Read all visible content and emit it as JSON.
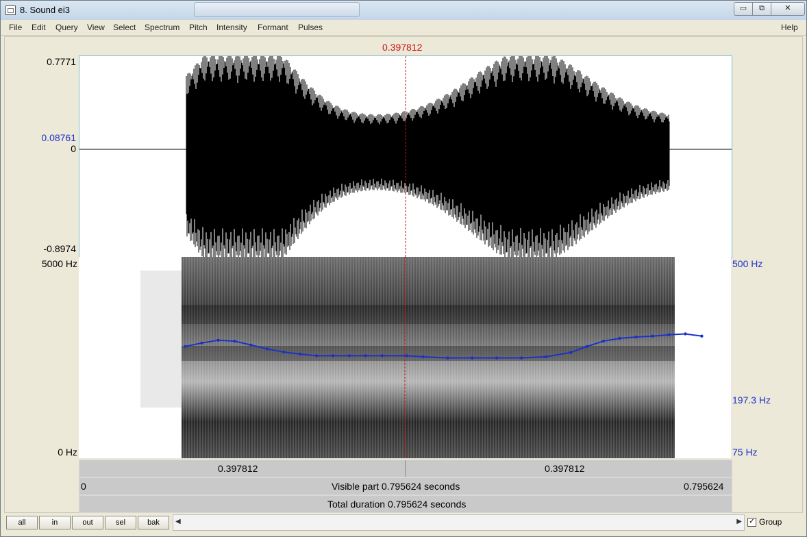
{
  "window": {
    "title": "8. Sound ei3",
    "minimize_label": "▭",
    "maximize_label": "⧉",
    "close_label": "✕"
  },
  "menu": {
    "items": [
      "File",
      "Edit",
      "Query",
      "View",
      "Select",
      "Spectrum",
      "Pitch",
      "Intensity",
      "Formant",
      "Pulses"
    ],
    "help": "Help"
  },
  "cursor": {
    "time_label": "0.397812",
    "time": 0.397812
  },
  "waveform": {
    "max_label": "0.7771",
    "mid_label": "0.08761",
    "zero_label": "0",
    "min_label": "-0.8974",
    "max": 0.7771,
    "min": -0.8974,
    "cursor_value": 0.08761
  },
  "spectrogram": {
    "freq_top_label": "5000 Hz",
    "freq_bottom_label": "0 Hz",
    "pitch_top_label": "500 Hz",
    "pitch_mid_label": "197.3 Hz",
    "pitch_bottom_label": "75 Hz",
    "pitch_color": "#1c31c9"
  },
  "pitch_track": {
    "unit": "Hz",
    "times": [
      0.13,
      0.15,
      0.17,
      0.19,
      0.21,
      0.23,
      0.25,
      0.27,
      0.29,
      0.31,
      0.33,
      0.35,
      0.37,
      0.4,
      0.42,
      0.45,
      0.48,
      0.51,
      0.54,
      0.57,
      0.6,
      0.62,
      0.64,
      0.66,
      0.68,
      0.7,
      0.72,
      0.74,
      0.76
    ],
    "values": [
      215,
      222,
      228,
      226,
      218,
      210,
      204,
      200,
      197,
      197,
      197,
      197,
      197,
      197,
      195,
      193,
      193,
      193,
      193,
      195,
      203,
      215,
      226,
      232,
      235,
      237,
      240,
      242,
      237
    ]
  },
  "selection_bar": {
    "left_label": "0.397812",
    "right_label": "0.397812"
  },
  "visible_bar": {
    "start_label": "0",
    "text": "Visible part 0.795624 seconds",
    "end_label": "0.795624"
  },
  "total_bar": {
    "text": "Total duration 0.795624 seconds"
  },
  "nav_buttons": {
    "all": "all",
    "in": "in",
    "out": "out",
    "sel": "sel",
    "bak": "bak"
  },
  "group": {
    "label": "Group",
    "checked": true,
    "check_mark": "✓"
  },
  "scroll": {
    "left_arrow": "◀",
    "right_arrow": "▶"
  }
}
